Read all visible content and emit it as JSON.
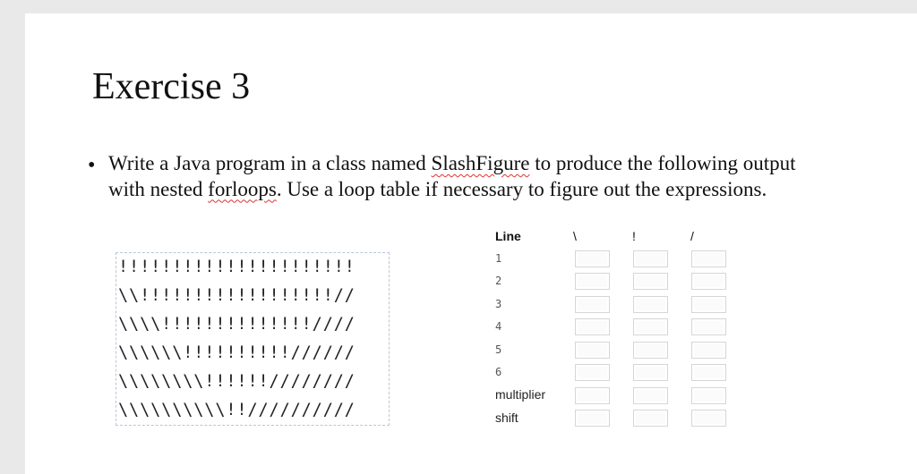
{
  "title": "Exercise 3",
  "bullet": {
    "before": "Write a Java program in a class named ",
    "class_name": "SlashFigure",
    "middle": " to produce the following output with nested ",
    "loops_word": "forloops",
    "after": ". Use a loop table if necessary to figure out the expressions."
  },
  "figure_lines": [
    "!!!!!!!!!!!!!!!!!!!!!!",
    "\\\\!!!!!!!!!!!!!!!!!!//",
    "\\\\\\\\!!!!!!!!!!!!!!////",
    "\\\\\\\\\\\\!!!!!!!!!!//////",
    "\\\\\\\\\\\\\\\\!!!!!!////////",
    "\\\\\\\\\\\\\\\\\\\\!!//////////"
  ],
  "loop_table": {
    "header_line": "Line",
    "header_backslash": "\\",
    "header_bang": "!",
    "header_slash": "/",
    "rows": [
      "1",
      "2",
      "3",
      "4",
      "5",
      "6",
      "multiplier",
      "shift"
    ]
  }
}
